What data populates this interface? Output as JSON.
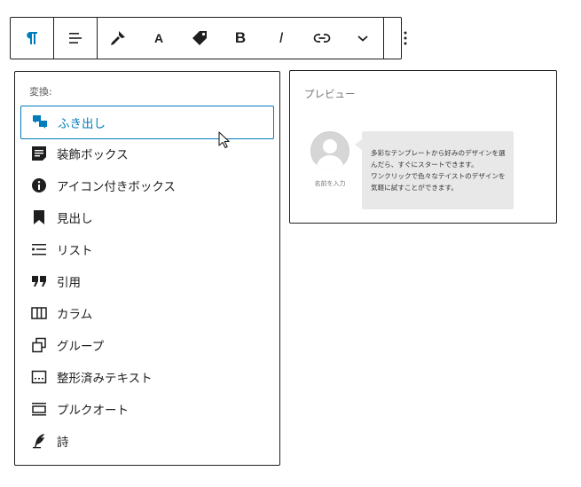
{
  "toolbar": {
    "groups": [
      [
        "paragraph-icon"
      ],
      [
        "align-left-icon"
      ],
      [
        "highlighter-icon",
        "text-color-icon",
        "tag-icon",
        "bold-icon",
        "italic-icon",
        "link-icon",
        "chevron-down-icon"
      ],
      [
        "more-vertical-icon"
      ]
    ],
    "text_color_label": "A",
    "bold_label": "B",
    "italic_label": "I",
    "accent_color": "#007cba"
  },
  "transform_menu": {
    "title": "変換:",
    "items": [
      {
        "label": "ふき出し",
        "icon": "speech-bubble-icon",
        "active": true
      },
      {
        "label": "装飾ボックス",
        "icon": "decorated-box-icon",
        "active": false
      },
      {
        "label": "アイコン付きボックス",
        "icon": "info-icon",
        "active": false
      },
      {
        "label": "見出し",
        "icon": "bookmark-icon",
        "active": false
      },
      {
        "label": "リスト",
        "icon": "list-icon",
        "active": false
      },
      {
        "label": "引用",
        "icon": "quote-icon",
        "active": false
      },
      {
        "label": "カラム",
        "icon": "columns-icon",
        "active": false
      },
      {
        "label": "グループ",
        "icon": "group-icon",
        "active": false
      },
      {
        "label": "整形済みテキスト",
        "icon": "preformatted-icon",
        "active": false
      },
      {
        "label": "プルクオート",
        "icon": "pullquote-icon",
        "active": false
      },
      {
        "label": "詩",
        "icon": "quill-icon",
        "active": false
      }
    ]
  },
  "preview": {
    "title": "プレビュー",
    "avatar_name": "名前を入力",
    "bubble_text": "多彩なテンプレートから好みのデザインを選んだら、すぐにスタートできます。\nワンクリックで色々なテイストのデザインを気軽に試すことができます。"
  }
}
